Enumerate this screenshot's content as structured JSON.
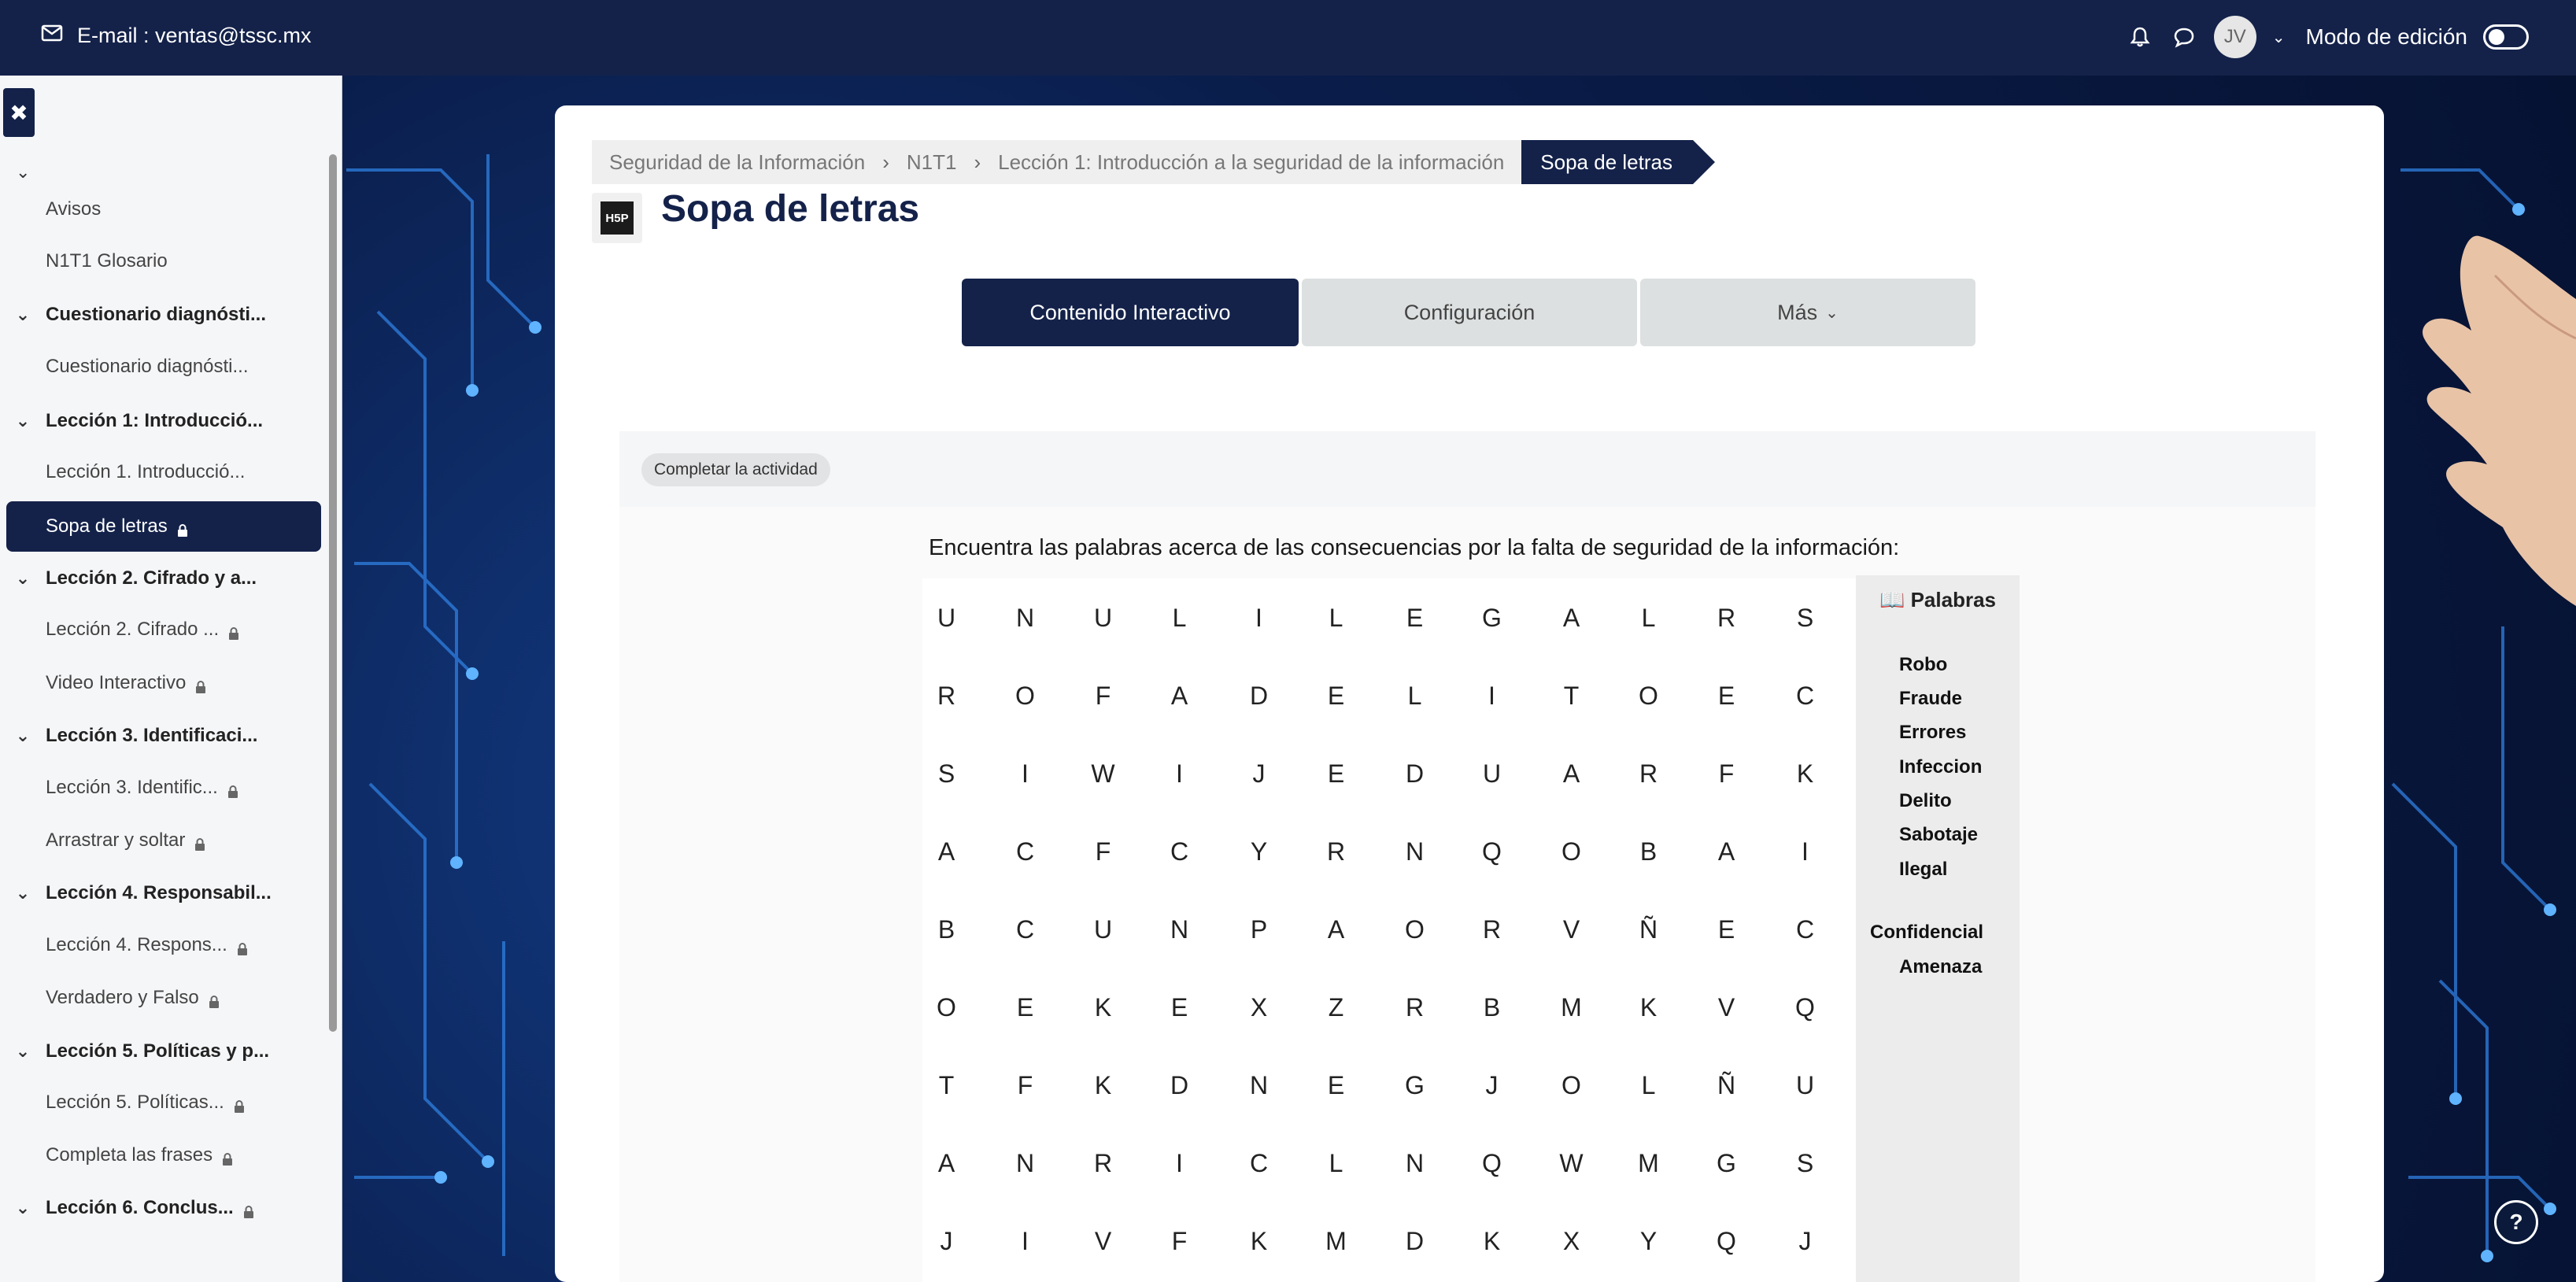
{
  "topbar": {
    "email": "E-mail : ventas@tssc.mx",
    "avatar_initials": "JV",
    "edit_mode_label": "Modo de edición"
  },
  "sidebar": {
    "items": [
      {
        "label": "Avisos",
        "type": "sub",
        "locked": false
      },
      {
        "label": "N1T1 Glosario",
        "type": "sub",
        "locked": false
      },
      {
        "label": "Cuestionario diagnósti...",
        "type": "section",
        "locked": false
      },
      {
        "label": "Cuestionario diagnósti...",
        "type": "sub",
        "locked": false
      },
      {
        "label": "Lección 1: Introducció...",
        "type": "section",
        "locked": false
      },
      {
        "label": "Lección 1. Introducció...",
        "type": "sub",
        "locked": false
      },
      {
        "label": "Sopa de letras",
        "type": "active",
        "locked": true
      },
      {
        "label": "Lección 2. Cifrado y a...",
        "type": "section",
        "locked": false
      },
      {
        "label": "Lección 2. Cifrado ...",
        "type": "sub",
        "locked": true
      },
      {
        "label": "Video Interactivo",
        "type": "sub",
        "locked": true
      },
      {
        "label": "Lección 3. Identificaci...",
        "type": "section",
        "locked": false
      },
      {
        "label": "Lección 3. Identific...",
        "type": "sub",
        "locked": true
      },
      {
        "label": "Arrastrar y soltar",
        "type": "sub",
        "locked": true
      },
      {
        "label": "Lección 4. Responsabil...",
        "type": "section",
        "locked": false
      },
      {
        "label": "Lección 4. Respons...",
        "type": "sub",
        "locked": true
      },
      {
        "label": "Verdadero y Falso",
        "type": "sub",
        "locked": true
      },
      {
        "label": "Lección 5. Políticas y p...",
        "type": "section",
        "locked": false
      },
      {
        "label": "Lección 5. Políticas...",
        "type": "sub",
        "locked": true
      },
      {
        "label": "Completa las frases",
        "type": "sub",
        "locked": true
      },
      {
        "label": "Lección 6. Conclus...",
        "type": "section",
        "locked": true
      }
    ]
  },
  "breadcrumb": {
    "items": [
      "Seguridad de la Información",
      "N1T1",
      "Lección 1: Introducción a la seguridad de la información"
    ],
    "current": "Sopa de letras"
  },
  "page": {
    "title": "Sopa de letras",
    "h5p_logo": "H5P"
  },
  "tabs": {
    "interactive": "Contenido Interactivo",
    "config": "Configuración",
    "more": "Más"
  },
  "completion": {
    "badge": "Completar la actividad"
  },
  "puzzle": {
    "instructions": "Encuentra las palabras acerca de las consecuencias por la falta de seguridad de la información:",
    "rows": [
      [
        "U",
        "N",
        "U",
        "L",
        "I",
        "L",
        "E",
        "G",
        "A",
        "L",
        "R",
        "S"
      ],
      [
        "R",
        "O",
        "F",
        "A",
        "D",
        "E",
        "L",
        "I",
        "T",
        "O",
        "E",
        "C"
      ],
      [
        "S",
        "I",
        "W",
        "I",
        "J",
        "E",
        "D",
        "U",
        "A",
        "R",
        "F",
        "K"
      ],
      [
        "A",
        "C",
        "F",
        "C",
        "Y",
        "R",
        "N",
        "Q",
        "O",
        "B",
        "A",
        "I"
      ],
      [
        "B",
        "C",
        "U",
        "N",
        "P",
        "A",
        "O",
        "R",
        "V",
        "Ñ",
        "E",
        "C"
      ],
      [
        "O",
        "E",
        "K",
        "E",
        "X",
        "Z",
        "R",
        "B",
        "M",
        "K",
        "V",
        "Q"
      ],
      [
        "T",
        "F",
        "K",
        "D",
        "N",
        "E",
        "G",
        "J",
        "O",
        "L",
        "Ñ",
        "U"
      ],
      [
        "A",
        "N",
        "R",
        "I",
        "C",
        "L",
        "N",
        "Q",
        "W",
        "M",
        "G",
        "S"
      ],
      [
        "J",
        "I",
        "V",
        "F",
        "K",
        "M",
        "D",
        "K",
        "X",
        "Y",
        "Q",
        "J"
      ]
    ],
    "words_title": "Palabras",
    "words": [
      "Robo",
      "Fraude",
      "Errores",
      "Infeccion",
      "Delito",
      "Sabotaje",
      "Ilegal",
      "Confidencial",
      "Amenaza"
    ]
  },
  "help": "?",
  "colors": {
    "navy": "#14224a",
    "tab_inactive": "#dde0e0"
  }
}
